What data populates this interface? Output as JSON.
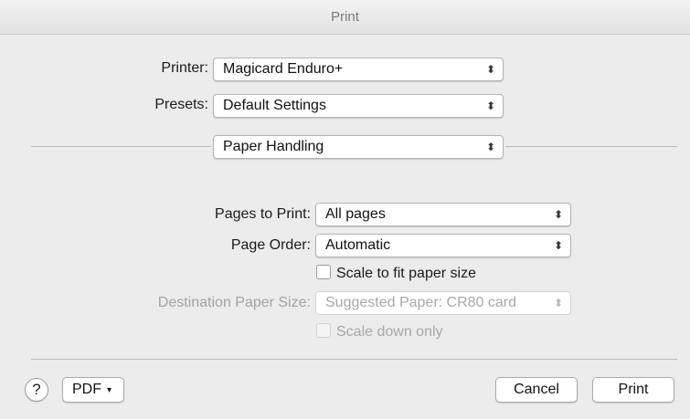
{
  "window": {
    "title": "Print"
  },
  "printer": {
    "label": "Printer:",
    "value": "Magicard Enduro+"
  },
  "presets": {
    "label": "Presets:",
    "value": "Default Settings"
  },
  "section": {
    "value": "Paper Handling"
  },
  "pages_to_print": {
    "label": "Pages to Print:",
    "value": "All pages"
  },
  "page_order": {
    "label": "Page Order:",
    "value": "Automatic"
  },
  "scale_to_fit": {
    "label": "Scale to fit paper size",
    "checked": false
  },
  "destination_paper_size": {
    "label": "Destination Paper Size:",
    "value": "Suggested Paper: CR80 card",
    "enabled": false
  },
  "scale_down_only": {
    "label": "Scale down only",
    "checked": false,
    "enabled": false
  },
  "footer": {
    "help_label": "?",
    "pdf_label": "PDF",
    "pdf_caret": "▾",
    "cancel_label": "Cancel",
    "print_label": "Print"
  },
  "icons": {
    "popup_arrows": "⌃⌄",
    "popup_glyph": "⬍"
  }
}
